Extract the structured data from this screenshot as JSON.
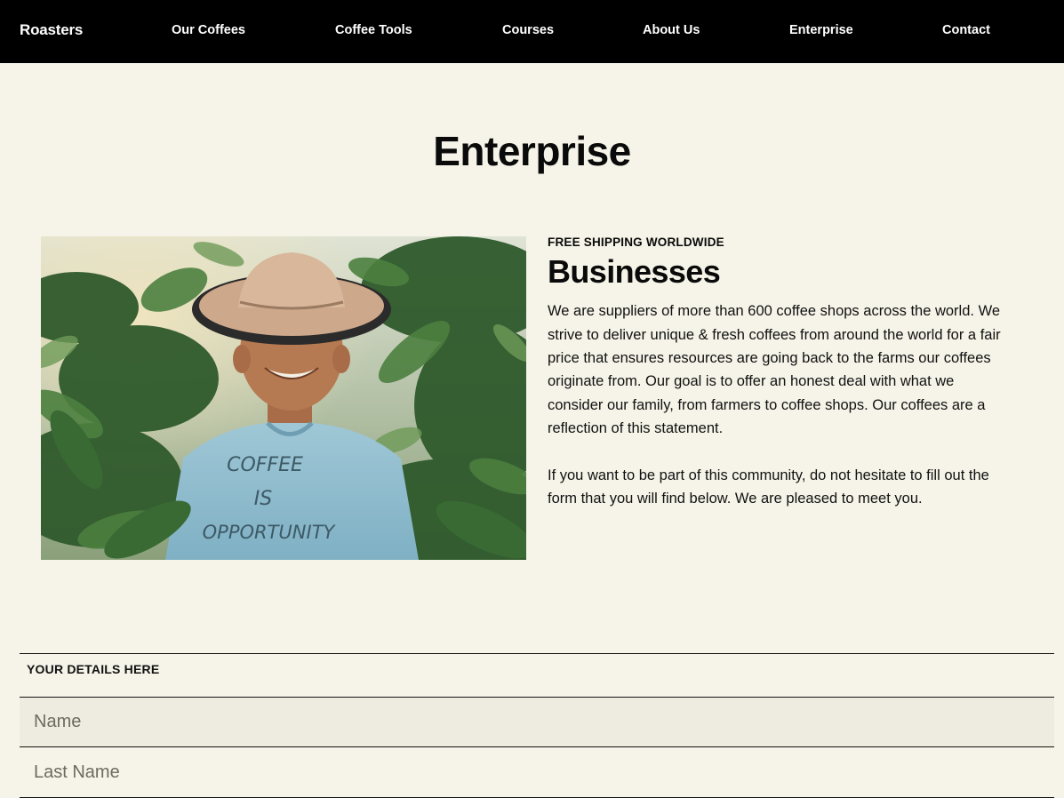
{
  "nav": {
    "brand": "Roasters",
    "links": [
      "Our Coffees",
      "Coffee Tools",
      "Courses",
      "About Us",
      "Enterprise",
      "Contact"
    ]
  },
  "page": {
    "title": "Enterprise"
  },
  "photo": {
    "shirt_text": [
      "COFFEE",
      "IS",
      "OPPORTUNITY"
    ]
  },
  "section": {
    "eyebrow": "FREE SHIPPING WORLDWIDE",
    "heading": "Businesses",
    "paragraphs": [
      "We are suppliers of more than 600 coffee shops across the world. We strive to deliver unique & fresh coffees from around the world for a fair price that ensures resources are going back to the farms our coffees originate from. Our goal is to offer an honest deal with what we consider our family, from farmers to coffee shops. Our coffees are a reflection of this statement.",
      "If you want to be part of this community, do not hesitate to fill out the form that you will find below. We are pleased to meet you."
    ]
  },
  "form": {
    "section_label": "YOUR DETAILS HERE",
    "name_placeholder": "Name",
    "last_name_placeholder": "Last Name"
  },
  "colors": {
    "nav_background": "#000000",
    "page_background": "#f6f4e8",
    "input_background": "#eeece0"
  }
}
